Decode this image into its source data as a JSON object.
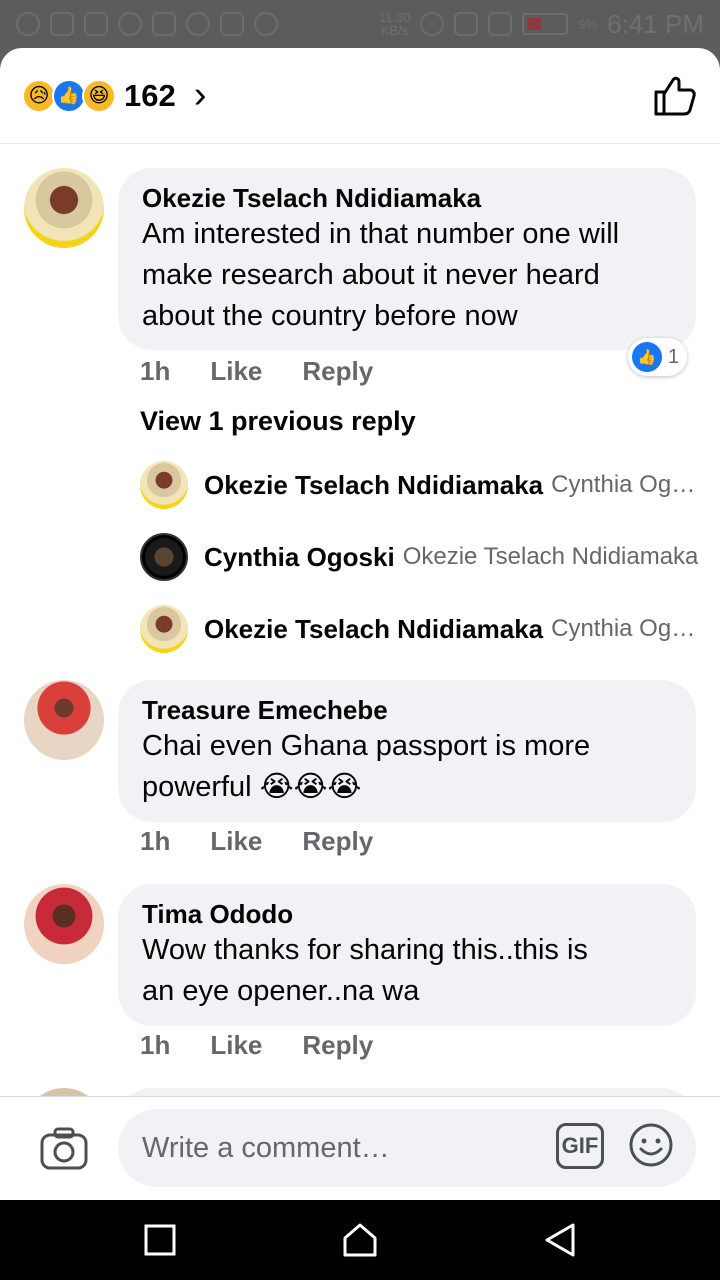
{
  "status_bar": {
    "time": "6:41 PM",
    "net_speed_top": "11.30",
    "net_speed_bottom": "KB/s",
    "battery_level": "9%"
  },
  "header": {
    "reaction_count": "162",
    "reactions": [
      "sad",
      "like",
      "haha"
    ]
  },
  "comments": [
    {
      "author": "Okezie Tselach Ndidiamaka",
      "text_lines": [
        "Am interested in that number one will",
        "make research about it never heard",
        "about the country before now"
      ],
      "time": "1h",
      "like_label": "Like",
      "reply_label": "Reply",
      "reaction_count": "1"
    },
    {
      "author": "Treasure Emechebe",
      "text_lines": [
        "Chai even Ghana passport is more",
        "powerful"
      ],
      "emojis": "😭😭😭",
      "time": "1h",
      "like_label": "Like",
      "reply_label": "Reply"
    },
    {
      "author": "Tima Ododo",
      "text_lines": [
        "Wow thanks for sharing this..this is",
        "an eye opener..na wa"
      ],
      "time": "1h",
      "like_label": "Like",
      "reply_label": "Reply"
    }
  ],
  "view_previous_reply": "View 1 previous reply",
  "replies": [
    {
      "author": "Okezie Tselach Ndidiamaka",
      "preview": "Cynthia Ogoski"
    },
    {
      "author": "Cynthia Ogoski",
      "preview": "Okezie Tselach Ndidiamaka"
    },
    {
      "author": "Okezie Tselach Ndidiamaka",
      "preview": "Cynthia Ogoski"
    }
  ],
  "composer": {
    "placeholder": "Write a comment…",
    "gif_label": "GIF"
  },
  "colors": {
    "accent_blue": "#1877f2",
    "bubble_bg": "#f0f2f5",
    "meta_gray": "#65676b"
  }
}
